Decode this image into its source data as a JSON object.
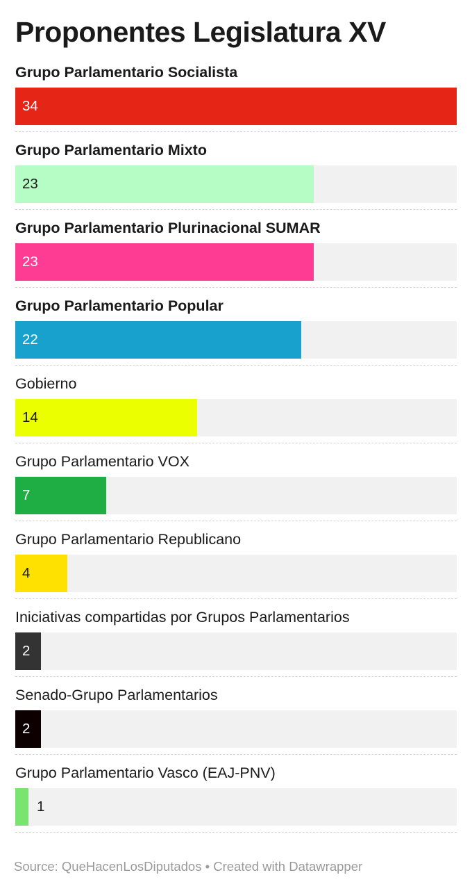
{
  "chart_data": {
    "type": "bar",
    "orientation": "horizontal",
    "title": "Proponentes Legislatura XV",
    "categories": [
      "Grupo Parlamentario Socialista",
      "Grupo Parlamentario Mixto",
      "Grupo Parlamentario Plurinacional SUMAR",
      "Grupo Parlamentario Popular",
      "Gobierno",
      "Grupo Parlamentario VOX",
      "Grupo Parlamentario Republicano",
      "Iniciativas compartidas por Grupos Parlamentarios",
      "Senado-Grupo Parlamentarios",
      "Grupo Parlamentario Vasco (EAJ-PNV)"
    ],
    "values": [
      34,
      23,
      23,
      22,
      14,
      7,
      4,
      2,
      2,
      1
    ],
    "colors": [
      "#e52515",
      "#b6fcc5",
      "#ff3c94",
      "#18a1cd",
      "#ebff00",
      "#1fae43",
      "#ffe100",
      "#333333",
      "#0d0000",
      "#7ae470"
    ],
    "label_colors": [
      "#ffffff",
      "#1a1a1a",
      "#ffffff",
      "#ffffff",
      "#1a1a1a",
      "#ffffff",
      "#1a1a1a",
      "#ffffff",
      "#ffffff",
      "#1a1a1a"
    ],
    "bold_labels": [
      true,
      true,
      true,
      true,
      false,
      false,
      false,
      false,
      false,
      false
    ],
    "xlim": [
      0,
      34
    ],
    "grid": false,
    "legend": "none"
  },
  "footer": {
    "text": "Source: QueHacenLosDiputados • Created with Datawrapper"
  }
}
